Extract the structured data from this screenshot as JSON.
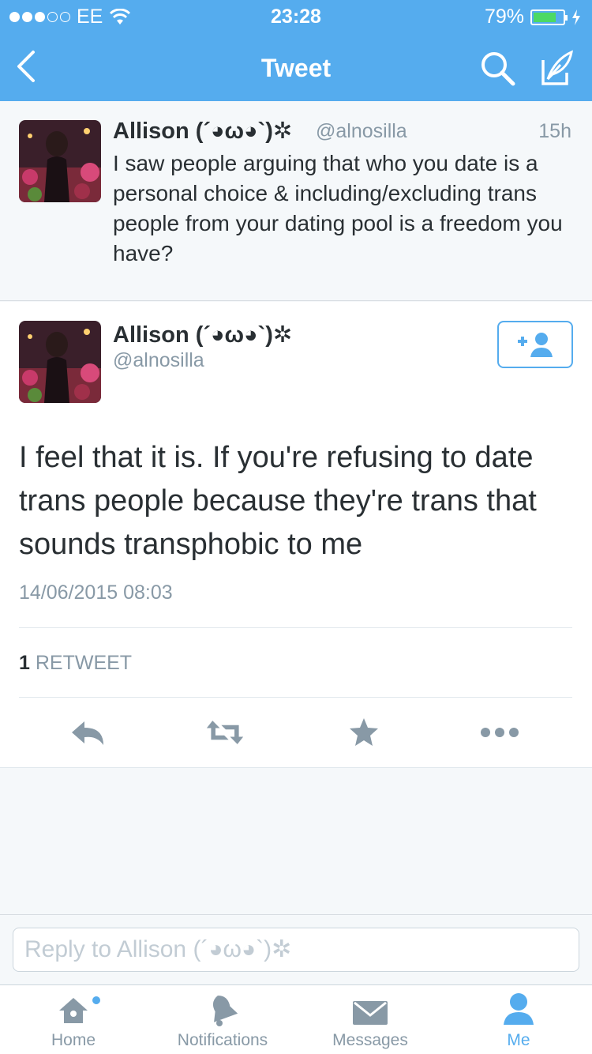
{
  "status_bar": {
    "carrier": "EE",
    "time": "23:28",
    "battery": "79%",
    "battery_level": 0.79
  },
  "nav": {
    "title": "Tweet"
  },
  "parent_tweet": {
    "name": "Allison (´◕ω◕`)✲",
    "handle": "@alnosilla",
    "age": "15h",
    "text": "I saw people arguing that who you date is a personal choice & including/excluding trans people from your dating pool is a freedom you have?"
  },
  "main_tweet": {
    "name": "Allison (´◕ω◕`)✲",
    "handle": "@alnosilla",
    "text": "I feel that it is. If you're refusing to date trans people because they're trans that sounds transphobic to me",
    "timestamp": "14/06/2015 08:03",
    "retweet_count": "1",
    "retweet_label": "RETWEET"
  },
  "reply": {
    "placeholder": "Reply to Allison (´◕ω◕`)✲"
  },
  "tabs": [
    {
      "label": "Home",
      "icon": "home-icon"
    },
    {
      "label": "Notifications",
      "icon": "bell-icon"
    },
    {
      "label": "Messages",
      "icon": "envelope-icon"
    },
    {
      "label": "Me",
      "icon": "person-icon"
    }
  ],
  "colors": {
    "brand": "#55acee",
    "muted": "#8899a6",
    "text": "#292f33"
  }
}
